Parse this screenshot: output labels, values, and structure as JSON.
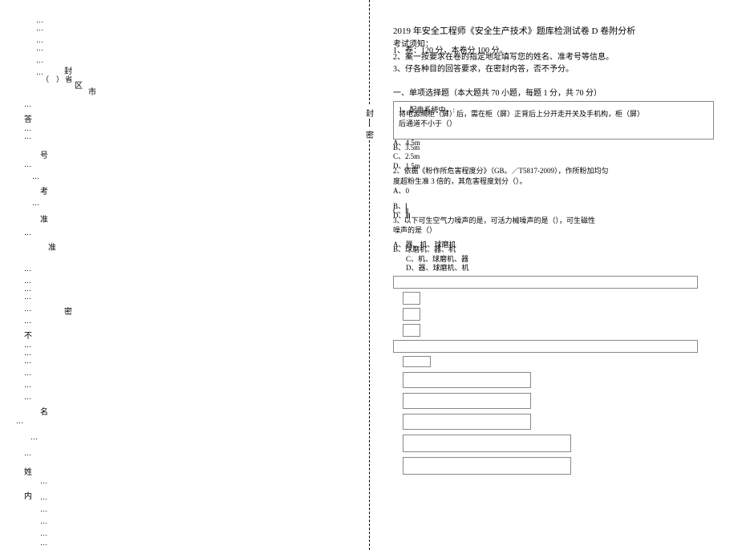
{
  "left": {
    "seal_top": "封",
    "district": "区",
    "city": "市",
    "province": "（　）    省",
    "answer": "答",
    "number": "号",
    "exam": "考",
    "zhun": "准",
    "zhun2": "准",
    "name": "名",
    "dense": "密",
    "bu": "不",
    "surname": "姓",
    "inner": "内",
    "dots": "…",
    "dots3": "…\n…\n…"
  },
  "center": {
    "seal_bottom": "封",
    "dense": "密"
  },
  "right": {
    "title": "2019 年安全工程师《安全生产技术》题库检测试卷 D 卷附分析",
    "subtitle": "考试须知：",
    "intro1": "1、卷：120 分，本卷分 100 分。",
    "intro2": "2、案一按要求在卷的指定地址填写您的姓名、准考号等信息。",
    "intro3": "3、仔各种目的回答要求，在密封内答，否不予分。",
    "section1": "一、单项选择题（本大题共 70 小题，每题 1 分，共 70 分）",
    "q1l1": "1、配电系统中，:",
    "q1l2": "将电源隔柜（屏）后，需在柜（屏）正背后上分开走开关及手机构，柜（屏）",
    "q1l3": "后通道不小于（）",
    "q1a": "A、4.5m",
    "q1b": "B、3.5m",
    "q1c": "C、2.5m",
    "q1d": "D、1.5m",
    "q2l1": "2、依据《粉作所危害程度分》（GB。／T5817-2009），作所粉加均匀",
    "q2l2": "度超粉生准 3 倍的，其危害程度划分（）。",
    "q2a": "A、0",
    "q2b": "B、Ⅰ",
    "q2c": "C、Ⅱ",
    "q2d": "D、Ⅲ",
    "q3l1": "3、以下可生空气力噪声的是，可活力械噪声的是（），可生磁性",
    "q3l2": "噪声的是（）",
    "q3a": "A、器、机、球磨机",
    "q3b": "B、球磨机、器、机",
    "q3c": "C、机、球磨机、器",
    "q3d": "D、器、球磨机、机"
  }
}
